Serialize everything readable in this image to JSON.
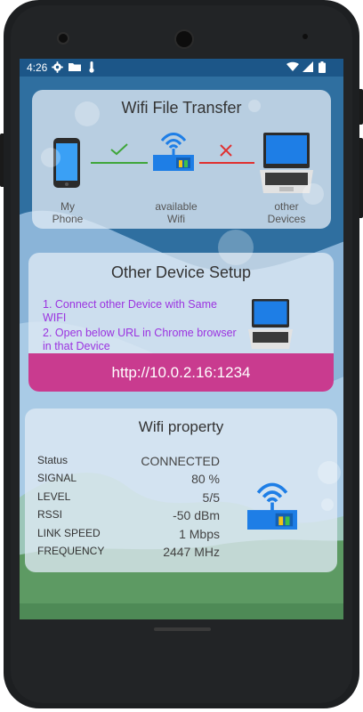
{
  "status_bar": {
    "time": "4:26",
    "icons": [
      "gear-icon",
      "folder-icon",
      "thermometer-icon",
      "wifi-signal-icon",
      "cell-signal-icon",
      "battery-icon"
    ]
  },
  "transfer_card": {
    "title": "Wifi File Transfer",
    "phone_label_line1": "My",
    "phone_label_line2": "Phone",
    "wifi_label_line1": "available",
    "wifi_label_line2": "Wifi",
    "devices_label_line1": "other",
    "devices_label_line2": "Devices",
    "colors": {
      "check": "#3fa63a",
      "cross": "#e03030"
    }
  },
  "setup_card": {
    "title": "Other Device Setup",
    "step1": "1. Connect other Device with Same WIFI",
    "step2": "2. Open below URL in Chrome browser in that Device",
    "url": "http://10.0.2.16:1234",
    "colors": {
      "instructions": "#9b33e0",
      "url_background": "#c93b8f"
    }
  },
  "wifi_property": {
    "title": "Wifi property",
    "rows": [
      {
        "key": "Status",
        "value": "CONNECTED"
      },
      {
        "key": "SIGNAL",
        "value": "80 %"
      },
      {
        "key": "LEVEL",
        "value": "5/5"
      },
      {
        "key": "RSSI",
        "value": "-50 dBm"
      },
      {
        "key": "LINK SPEED",
        "value": "1 Mbps"
      },
      {
        "key": "FREQUENCY",
        "value": "2447 MHz"
      }
    ]
  }
}
